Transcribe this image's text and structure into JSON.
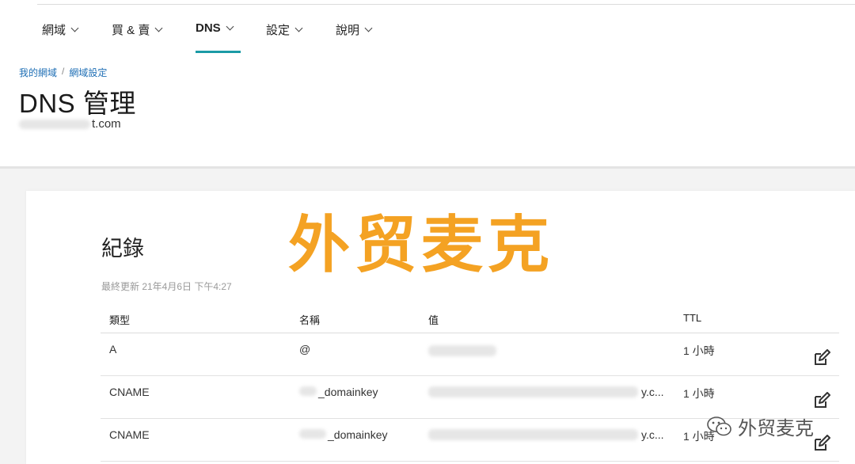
{
  "nav": {
    "items": [
      {
        "label": "網域"
      },
      {
        "label": "買 & 賣"
      },
      {
        "label": "DNS"
      },
      {
        "label": "設定"
      },
      {
        "label": "說明"
      }
    ]
  },
  "breadcrumb": {
    "items": [
      "我的網域",
      "網域設定"
    ],
    "separator": "/"
  },
  "page": {
    "title": "DNS 管理",
    "domain_suffix": "t.com"
  },
  "records": {
    "title": "紀錄",
    "updated": "最終更新 21年4月6日 下午4:27",
    "columns": [
      "類型",
      "名稱",
      "值",
      "TTL"
    ],
    "rows": [
      {
        "type": "A",
        "name": "@",
        "value": "",
        "ttl": "1 小時"
      },
      {
        "type": "CNAME",
        "name": "_domainkey",
        "value": "y.c...",
        "ttl": "1 小時"
      },
      {
        "type": "CNAME",
        "name": "_domainkey",
        "value": "y.c...",
        "ttl": "1 小時"
      }
    ]
  },
  "watermark": {
    "big": "外贸麦克",
    "small": "外贸麦克"
  },
  "colors": {
    "accent": "#1b9aa6",
    "link": "#1f6fb5",
    "watermark": "#f4a223"
  },
  "icons": {
    "nav_dropdown": "chevron-down-icon",
    "row_action": "edit-icon",
    "watermark_logo": "wechat-icon"
  }
}
